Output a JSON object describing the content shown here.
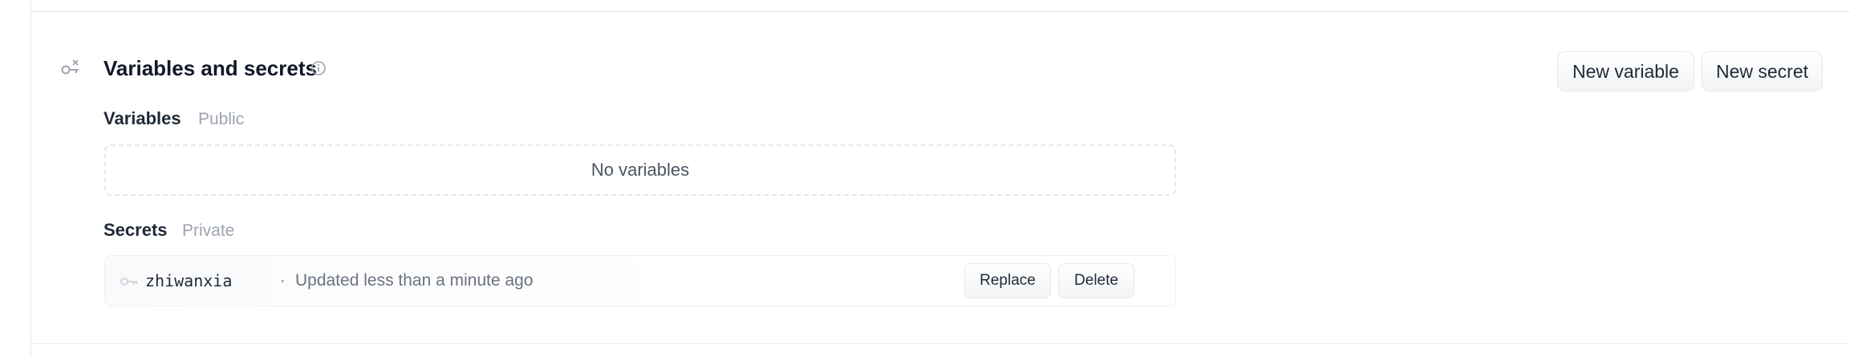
{
  "section": {
    "title": "Variables and secrets",
    "icon": "key-with-x-icon",
    "info_icon": "info-circle-icon"
  },
  "header_buttons": {
    "new_variable": "New variable",
    "new_secret": "New secret"
  },
  "variables": {
    "label": "Variables",
    "tag": "Public",
    "empty_text": "No variables",
    "items": []
  },
  "secrets": {
    "label": "Secrets",
    "tag": "Private",
    "items": [
      {
        "name": "zhiwanxia",
        "separator": "·",
        "updated": "Updated less than a minute ago",
        "replace_label": "Replace",
        "delete_label": "Delete"
      }
    ]
  },
  "colors": {
    "border": "#e5e7eb",
    "muted_text": "#9ca3af",
    "secondary_text": "#6b7280",
    "primary_text": "#111827"
  }
}
